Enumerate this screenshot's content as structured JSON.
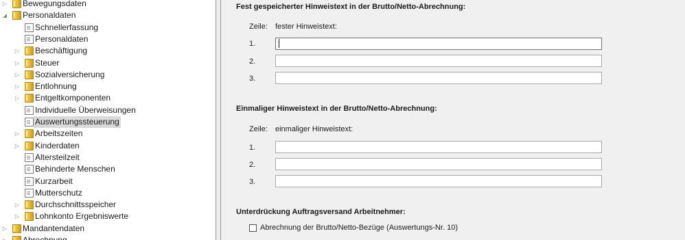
{
  "tree": {
    "items": [
      {
        "label": "Bewegungsdaten",
        "icon": "folder-icon",
        "expander": "collapsed",
        "level": 0
      },
      {
        "label": "Personaldaten",
        "icon": "folder-icon",
        "expander": "expanded",
        "level": 0
      },
      {
        "label": "Schnellerfassung",
        "icon": "document-icon",
        "expander": "none",
        "level": 1
      },
      {
        "label": "Personaldaten",
        "icon": "document-icon",
        "expander": "none",
        "level": 1
      },
      {
        "label": "Beschäftigung",
        "icon": "folder-icon",
        "expander": "collapsed",
        "level": 1
      },
      {
        "label": "Steuer",
        "icon": "folder-icon",
        "expander": "collapsed",
        "level": 1
      },
      {
        "label": "Sozialversicherung",
        "icon": "folder-icon",
        "expander": "collapsed",
        "level": 1
      },
      {
        "label": "Entlohnung",
        "icon": "folder-icon",
        "expander": "collapsed",
        "level": 1
      },
      {
        "label": "Entgeltkomponenten",
        "icon": "folder-icon",
        "expander": "collapsed",
        "level": 1
      },
      {
        "label": "Individuelle Überweisungen",
        "icon": "document-icon",
        "expander": "none",
        "level": 1
      },
      {
        "label": "Auswertungssteuerung",
        "icon": "document-icon",
        "expander": "none",
        "level": 1,
        "selected": true
      },
      {
        "label": "Arbeitszeiten",
        "icon": "folder-icon",
        "expander": "collapsed",
        "level": 1
      },
      {
        "label": "Kinderdaten",
        "icon": "folder-icon",
        "expander": "collapsed",
        "level": 1
      },
      {
        "label": "Altersteilzeit",
        "icon": "document-icon",
        "expander": "none",
        "level": 1
      },
      {
        "label": "Behinderte Menschen",
        "icon": "document-icon",
        "expander": "none",
        "level": 1
      },
      {
        "label": "Kurzarbeit",
        "icon": "document-icon",
        "expander": "none",
        "level": 1
      },
      {
        "label": "Mutterschutz",
        "icon": "document-icon",
        "expander": "none",
        "level": 1
      },
      {
        "label": "Durchschnittsspeicher",
        "icon": "folder-icon",
        "expander": "collapsed",
        "level": 1
      },
      {
        "label": "Lohnkonto Ergebniswerte",
        "icon": "folder-icon",
        "expander": "collapsed",
        "level": 1
      },
      {
        "label": "Mandantendaten",
        "icon": "folder-icon",
        "expander": "collapsed",
        "level": 0
      },
      {
        "label": "Abrechnung",
        "icon": "folder-icon",
        "expander": "collapsed",
        "level": 0
      }
    ]
  },
  "form": {
    "section1": {
      "heading": "Fest gespeicherter Hinweistext in der Brutto/Netto-Abrechnung:",
      "zeile_label": "Zeile:",
      "column_label": "fester Hinweistext:",
      "rows": [
        {
          "num": "1.",
          "value": ""
        },
        {
          "num": "2.",
          "value": ""
        },
        {
          "num": "3.",
          "value": ""
        }
      ]
    },
    "section2": {
      "heading": "Einmaliger Hinweistext in der Brutto/Netto-Abrechnung:",
      "zeile_label": "Zeile:",
      "column_label": "einmaliger Hinweistext:",
      "rows": [
        {
          "num": "1.",
          "value": ""
        },
        {
          "num": "2.",
          "value": ""
        },
        {
          "num": "3.",
          "value": ""
        }
      ]
    },
    "section3": {
      "heading": "Unterdrückung Auftragsversand Arbeitnehmer:",
      "checkbox_label": "Abrechnung der Brutto/Netto-Bezüge (Auswertungs-Nr. 10)",
      "checked": false
    }
  }
}
